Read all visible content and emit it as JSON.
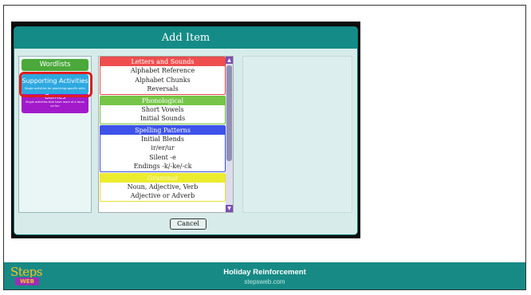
{
  "dialog": {
    "title": "Add Item",
    "cancel_label": "Cancel"
  },
  "categories": {
    "wordlists": "Wordlists",
    "supporting_title": "Supporting Activities",
    "supporting_sub": "Single activities for practicing specific skills",
    "games_title": "Games",
    "games_sub": "Single activities that have more of a focus on fun"
  },
  "groups": [
    {
      "name": "Letters and Sounds",
      "items": [
        "Alphabet Reference",
        "Alphabet Chunks",
        "Reversals"
      ]
    },
    {
      "name": "Phonological",
      "items": [
        "Short Vowels",
        "Initial Sounds"
      ]
    },
    {
      "name": "Spelling Patterns",
      "items": [
        "Initial Blends",
        "ir/er/ur",
        "Silent -e",
        "Endings -k/-ke/-ck"
      ]
    },
    {
      "name": "Grammar",
      "items": [
        "Noun, Adjective, Verb",
        "Adjective or Adverb"
      ]
    }
  ],
  "footer": {
    "logo_top": "Steps",
    "logo_bottom": "WEB",
    "title": "Holiday Reinforcement",
    "url": "stepsweb.com"
  },
  "colors": {
    "teal": "#148b86",
    "highlight": "#e01c1c",
    "letters": "#ee4e4e",
    "phonological": "#75c648",
    "spelling": "#3d53ea",
    "grammar": "#ecec2f"
  }
}
